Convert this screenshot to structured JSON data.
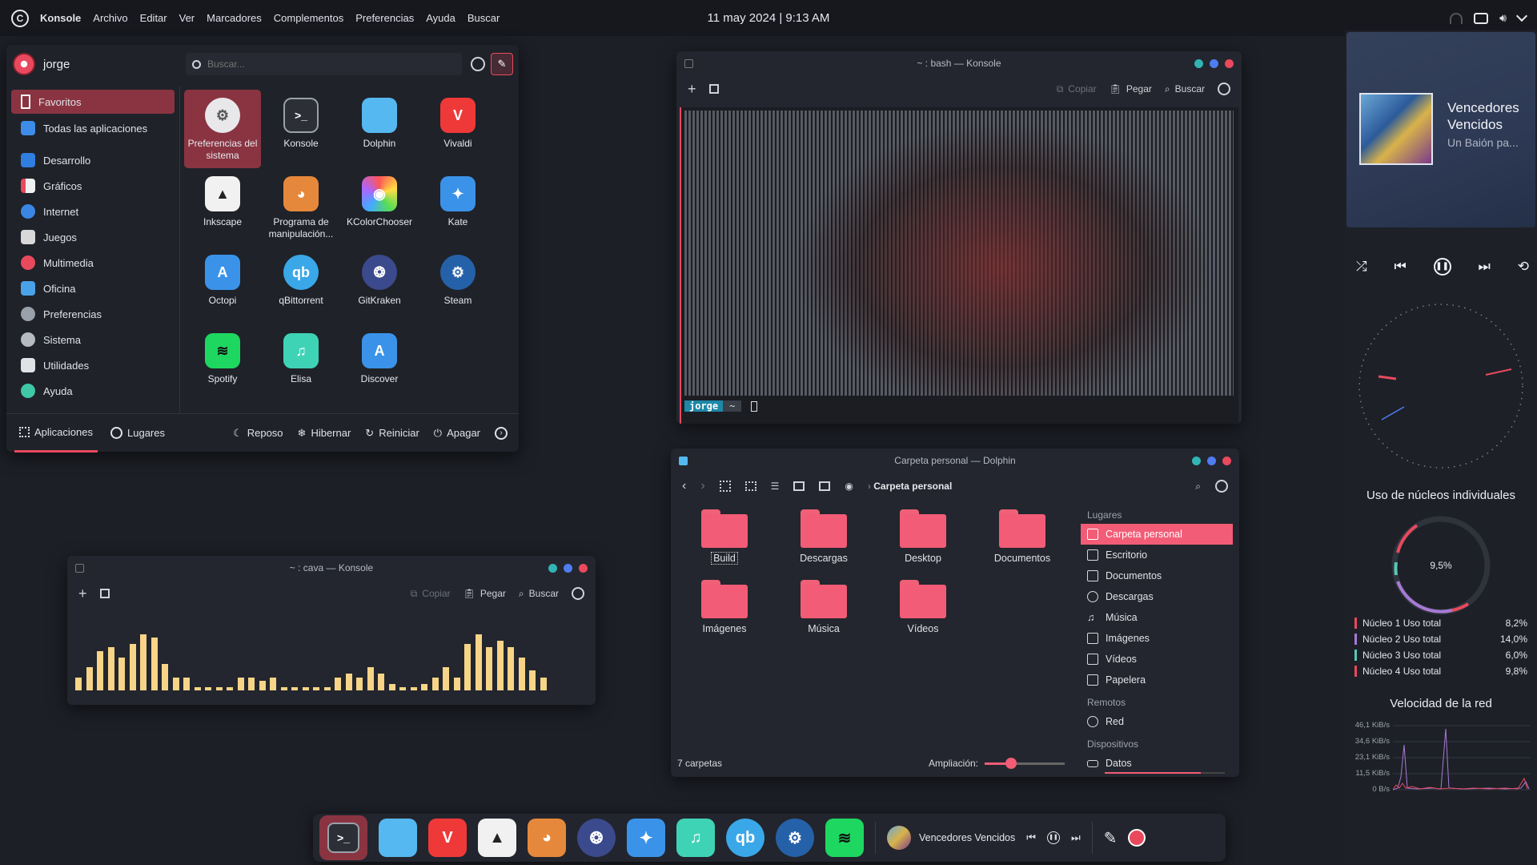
{
  "topbar": {
    "menu": [
      "Konsole",
      "Archivo",
      "Editar",
      "Ver",
      "Marcadores",
      "Complementos",
      "Preferencias",
      "Ayuda",
      "Buscar"
    ],
    "clock": "11 may 2024 | 9:13 AM"
  },
  "launcher": {
    "user": "jorge",
    "search_placeholder": "Buscar...",
    "categories": [
      "Favoritos",
      "Todas las aplicaciones",
      "Desarrollo",
      "Gráficos",
      "Internet",
      "Juegos",
      "Multimedia",
      "Oficina",
      "Preferencias",
      "Sistema",
      "Utilidades",
      "Ayuda"
    ],
    "apps": [
      "Preferencias del sistema",
      "Konsole",
      "Dolphin",
      "Vivaldi",
      "Inkscape",
      "Programa de manipulación...",
      "KColorChooser",
      "Kate",
      "Octopi",
      "qBittorrent",
      "GitKraken",
      "Steam",
      "Spotify",
      "Elisa",
      "Discover"
    ],
    "bottom": {
      "apps_tab": "Aplicaciones",
      "places_tab": "Lugares",
      "sleep": "Reposo",
      "hibernate": "Hibernar",
      "restart": "Reiniciar",
      "shutdown": "Apagar"
    }
  },
  "konsole_bash": {
    "title": "~ : bash — Konsole",
    "copy": "Copiar",
    "paste": "Pegar",
    "search": "Buscar",
    "prompt_user": "jorge",
    "prompt_dir": "~"
  },
  "konsole_cava": {
    "title": "~ : cava — Konsole",
    "copy": "Copiar",
    "paste": "Pegar",
    "search": "Buscar",
    "bars": [
      4,
      7,
      12,
      13,
      10,
      14,
      17,
      16,
      8,
      4,
      4,
      1,
      1,
      1,
      1,
      4,
      4,
      3,
      4,
      1,
      1,
      1,
      1,
      1,
      4,
      5,
      4,
      7,
      5,
      2,
      1,
      1,
      2,
      4,
      7,
      4,
      14,
      17,
      13,
      15,
      13,
      10,
      6,
      4
    ]
  },
  "dolphin": {
    "title": "Carpeta personal — Dolphin",
    "path": "Carpeta personal",
    "folders": [
      "Build",
      "Descargas",
      "Desktop",
      "Documentos",
      "Imágenes",
      "Música",
      "Vídeos"
    ],
    "places_header": "Lugares",
    "places": [
      "Carpeta personal",
      "Escritorio",
      "Documentos",
      "Descargas",
      "Música",
      "Imágenes",
      "Vídeos",
      "Papelera"
    ],
    "remote_header": "Remotos",
    "remote": [
      "Red"
    ],
    "devices_header": "Dispositivos",
    "devices": [
      "Datos"
    ],
    "status": "7 carpetas",
    "zoom_label": "Ampliación:",
    "zoom_value": 0.33
  },
  "media": {
    "title": "Vencedores Vencidos",
    "subtitle": "Un Baión pa..."
  },
  "cores": {
    "title": "Uso de núcleos individuales",
    "total": "9,5%",
    "rows": [
      {
        "name": "Núcleo 1 Uso total",
        "value": "8,2%",
        "color": "#e9495d"
      },
      {
        "name": "Núcleo 2 Uso total",
        "value": "14,0%",
        "color": "#a77ad6"
      },
      {
        "name": "Núcleo 3 Uso total",
        "value": "6,0%",
        "color": "#59c7b8"
      },
      {
        "name": "Núcleo 4 Uso total",
        "value": "9,8%",
        "color": "#e9495d"
      }
    ]
  },
  "network": {
    "title": "Velocidad de la red",
    "ticks": [
      "46,1 KiB/s",
      "34,6 KiB/s",
      "23,1 KiB/s",
      "11,5 KiB/s",
      "0 B/s"
    ]
  },
  "dock": {
    "now_playing": "Vencedores Vencidos"
  },
  "colors": {
    "accent": "#f25c76",
    "terminal_bg": "#1b1d23",
    "cava_bar": "#f7d487"
  }
}
